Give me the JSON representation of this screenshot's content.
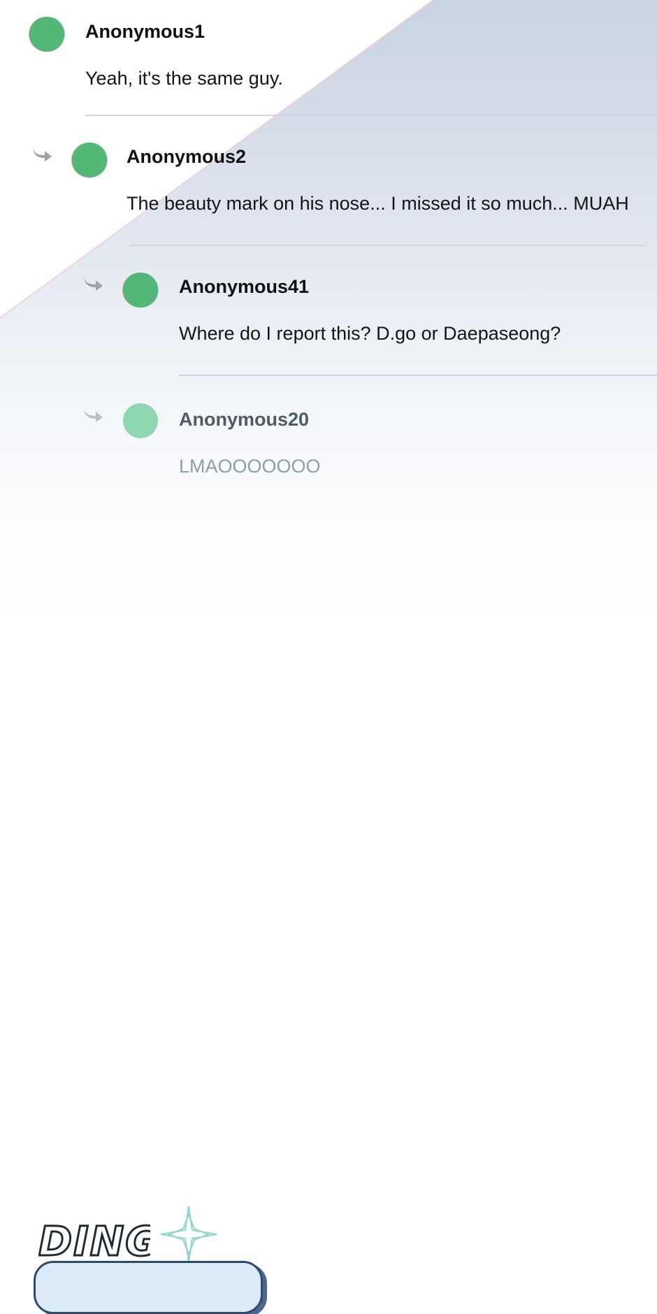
{
  "comments": [
    {
      "username": "Anonymous1",
      "message": "Yeah, it's the same guy."
    },
    {
      "username": "Anonymous2",
      "message": "The beauty mark on his nose... I missed it so much... MUAH"
    },
    {
      "username": "Anonymous41",
      "message": "Where do I report this? D.go or Daepaseong?"
    },
    {
      "username": "Anonymous20",
      "message": "LMAOOOOOOO"
    }
  ],
  "sfx": {
    "text": "DING"
  },
  "colors": {
    "avatar": "#52b777",
    "avatar_faded": "#8fd6b2",
    "divider": "#cfd6df",
    "bubble_fill": "#dcebf7",
    "bubble_stroke": "#2d4b6e"
  },
  "icons": {
    "reply": "reply-arrow-icon",
    "sparkle": "sparkle-icon"
  }
}
